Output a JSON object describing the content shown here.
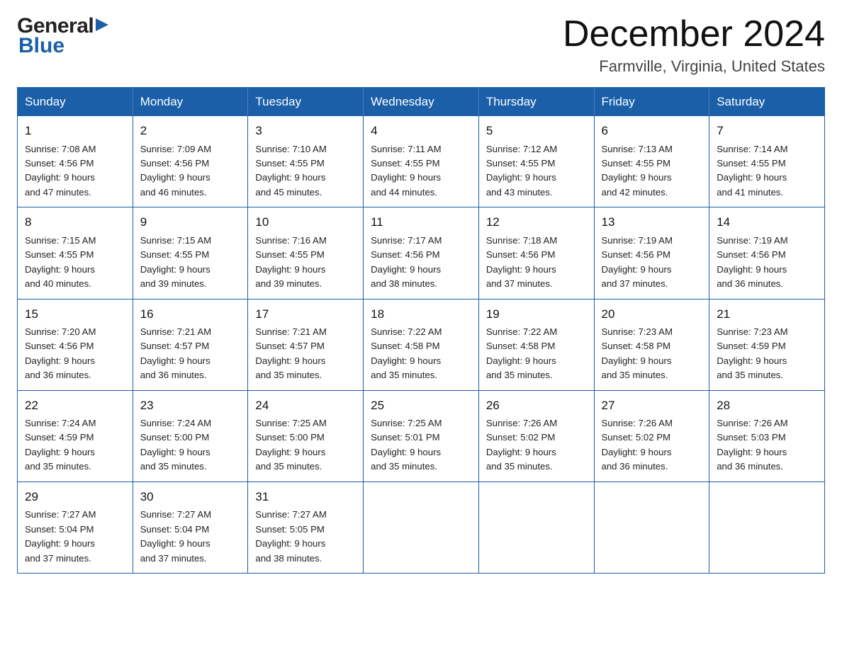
{
  "header": {
    "logo": {
      "general_text": "General",
      "blue_text": "Blue"
    },
    "title": "December 2024",
    "location": "Farmville, Virginia, United States"
  },
  "calendar": {
    "days_of_week": [
      "Sunday",
      "Monday",
      "Tuesday",
      "Wednesday",
      "Thursday",
      "Friday",
      "Saturday"
    ],
    "weeks": [
      [
        {
          "day": "1",
          "sunrise": "7:08 AM",
          "sunset": "4:56 PM",
          "daylight": "9 hours and 47 minutes."
        },
        {
          "day": "2",
          "sunrise": "7:09 AM",
          "sunset": "4:56 PM",
          "daylight": "9 hours and 46 minutes."
        },
        {
          "day": "3",
          "sunrise": "7:10 AM",
          "sunset": "4:55 PM",
          "daylight": "9 hours and 45 minutes."
        },
        {
          "day": "4",
          "sunrise": "7:11 AM",
          "sunset": "4:55 PM",
          "daylight": "9 hours and 44 minutes."
        },
        {
          "day": "5",
          "sunrise": "7:12 AM",
          "sunset": "4:55 PM",
          "daylight": "9 hours and 43 minutes."
        },
        {
          "day": "6",
          "sunrise": "7:13 AM",
          "sunset": "4:55 PM",
          "daylight": "9 hours and 42 minutes."
        },
        {
          "day": "7",
          "sunrise": "7:14 AM",
          "sunset": "4:55 PM",
          "daylight": "9 hours and 41 minutes."
        }
      ],
      [
        {
          "day": "8",
          "sunrise": "7:15 AM",
          "sunset": "4:55 PM",
          "daylight": "9 hours and 40 minutes."
        },
        {
          "day": "9",
          "sunrise": "7:15 AM",
          "sunset": "4:55 PM",
          "daylight": "9 hours and 39 minutes."
        },
        {
          "day": "10",
          "sunrise": "7:16 AM",
          "sunset": "4:55 PM",
          "daylight": "9 hours and 39 minutes."
        },
        {
          "day": "11",
          "sunrise": "7:17 AM",
          "sunset": "4:56 PM",
          "daylight": "9 hours and 38 minutes."
        },
        {
          "day": "12",
          "sunrise": "7:18 AM",
          "sunset": "4:56 PM",
          "daylight": "9 hours and 37 minutes."
        },
        {
          "day": "13",
          "sunrise": "7:19 AM",
          "sunset": "4:56 PM",
          "daylight": "9 hours and 37 minutes."
        },
        {
          "day": "14",
          "sunrise": "7:19 AM",
          "sunset": "4:56 PM",
          "daylight": "9 hours and 36 minutes."
        }
      ],
      [
        {
          "day": "15",
          "sunrise": "7:20 AM",
          "sunset": "4:56 PM",
          "daylight": "9 hours and 36 minutes."
        },
        {
          "day": "16",
          "sunrise": "7:21 AM",
          "sunset": "4:57 PM",
          "daylight": "9 hours and 36 minutes."
        },
        {
          "day": "17",
          "sunrise": "7:21 AM",
          "sunset": "4:57 PM",
          "daylight": "9 hours and 35 minutes."
        },
        {
          "day": "18",
          "sunrise": "7:22 AM",
          "sunset": "4:58 PM",
          "daylight": "9 hours and 35 minutes."
        },
        {
          "day": "19",
          "sunrise": "7:22 AM",
          "sunset": "4:58 PM",
          "daylight": "9 hours and 35 minutes."
        },
        {
          "day": "20",
          "sunrise": "7:23 AM",
          "sunset": "4:58 PM",
          "daylight": "9 hours and 35 minutes."
        },
        {
          "day": "21",
          "sunrise": "7:23 AM",
          "sunset": "4:59 PM",
          "daylight": "9 hours and 35 minutes."
        }
      ],
      [
        {
          "day": "22",
          "sunrise": "7:24 AM",
          "sunset": "4:59 PM",
          "daylight": "9 hours and 35 minutes."
        },
        {
          "day": "23",
          "sunrise": "7:24 AM",
          "sunset": "5:00 PM",
          "daylight": "9 hours and 35 minutes."
        },
        {
          "day": "24",
          "sunrise": "7:25 AM",
          "sunset": "5:00 PM",
          "daylight": "9 hours and 35 minutes."
        },
        {
          "day": "25",
          "sunrise": "7:25 AM",
          "sunset": "5:01 PM",
          "daylight": "9 hours and 35 minutes."
        },
        {
          "day": "26",
          "sunrise": "7:26 AM",
          "sunset": "5:02 PM",
          "daylight": "9 hours and 35 minutes."
        },
        {
          "day": "27",
          "sunrise": "7:26 AM",
          "sunset": "5:02 PM",
          "daylight": "9 hours and 36 minutes."
        },
        {
          "day": "28",
          "sunrise": "7:26 AM",
          "sunset": "5:03 PM",
          "daylight": "9 hours and 36 minutes."
        }
      ],
      [
        {
          "day": "29",
          "sunrise": "7:27 AM",
          "sunset": "5:04 PM",
          "daylight": "9 hours and 37 minutes."
        },
        {
          "day": "30",
          "sunrise": "7:27 AM",
          "sunset": "5:04 PM",
          "daylight": "9 hours and 37 minutes."
        },
        {
          "day": "31",
          "sunrise": "7:27 AM",
          "sunset": "5:05 PM",
          "daylight": "9 hours and 38 minutes."
        },
        null,
        null,
        null,
        null
      ]
    ]
  },
  "labels": {
    "sunrise_prefix": "Sunrise: ",
    "sunset_prefix": "Sunset: ",
    "daylight_prefix": "Daylight: "
  }
}
